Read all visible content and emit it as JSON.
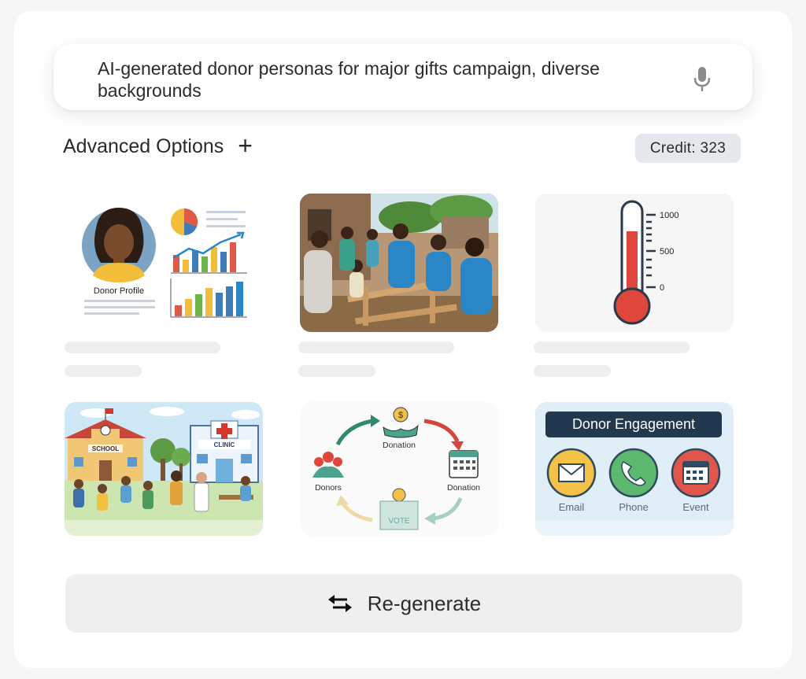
{
  "search": {
    "prompt": "AI-generated donor personas for major gifts campaign, diverse backgrounds"
  },
  "options": {
    "advanced_label": "Advanced Options",
    "add_symbol": "+",
    "credit_label": "Credit: 323"
  },
  "cards": {
    "donor_profile": {
      "caption": "Donor Profile"
    },
    "thermometer": {
      "ticks": [
        "1000",
        "500",
        "0"
      ]
    },
    "community": {
      "school_sign": "SCHOOL",
      "clinic_sign": "CLINIC"
    },
    "cycle": {
      "labels": [
        "Donation",
        "Donation",
        "Donors"
      ],
      "box_label": "VOTE"
    },
    "engagement": {
      "title": "Donor Engagement",
      "channels": [
        "Email",
        "Phone",
        "Event"
      ]
    }
  },
  "regenerate": {
    "label": "Re-generate"
  },
  "colors": {
    "accent_blue": "#2b86c8",
    "thermo_red": "#e0473c",
    "panel_navy": "#22384f"
  }
}
